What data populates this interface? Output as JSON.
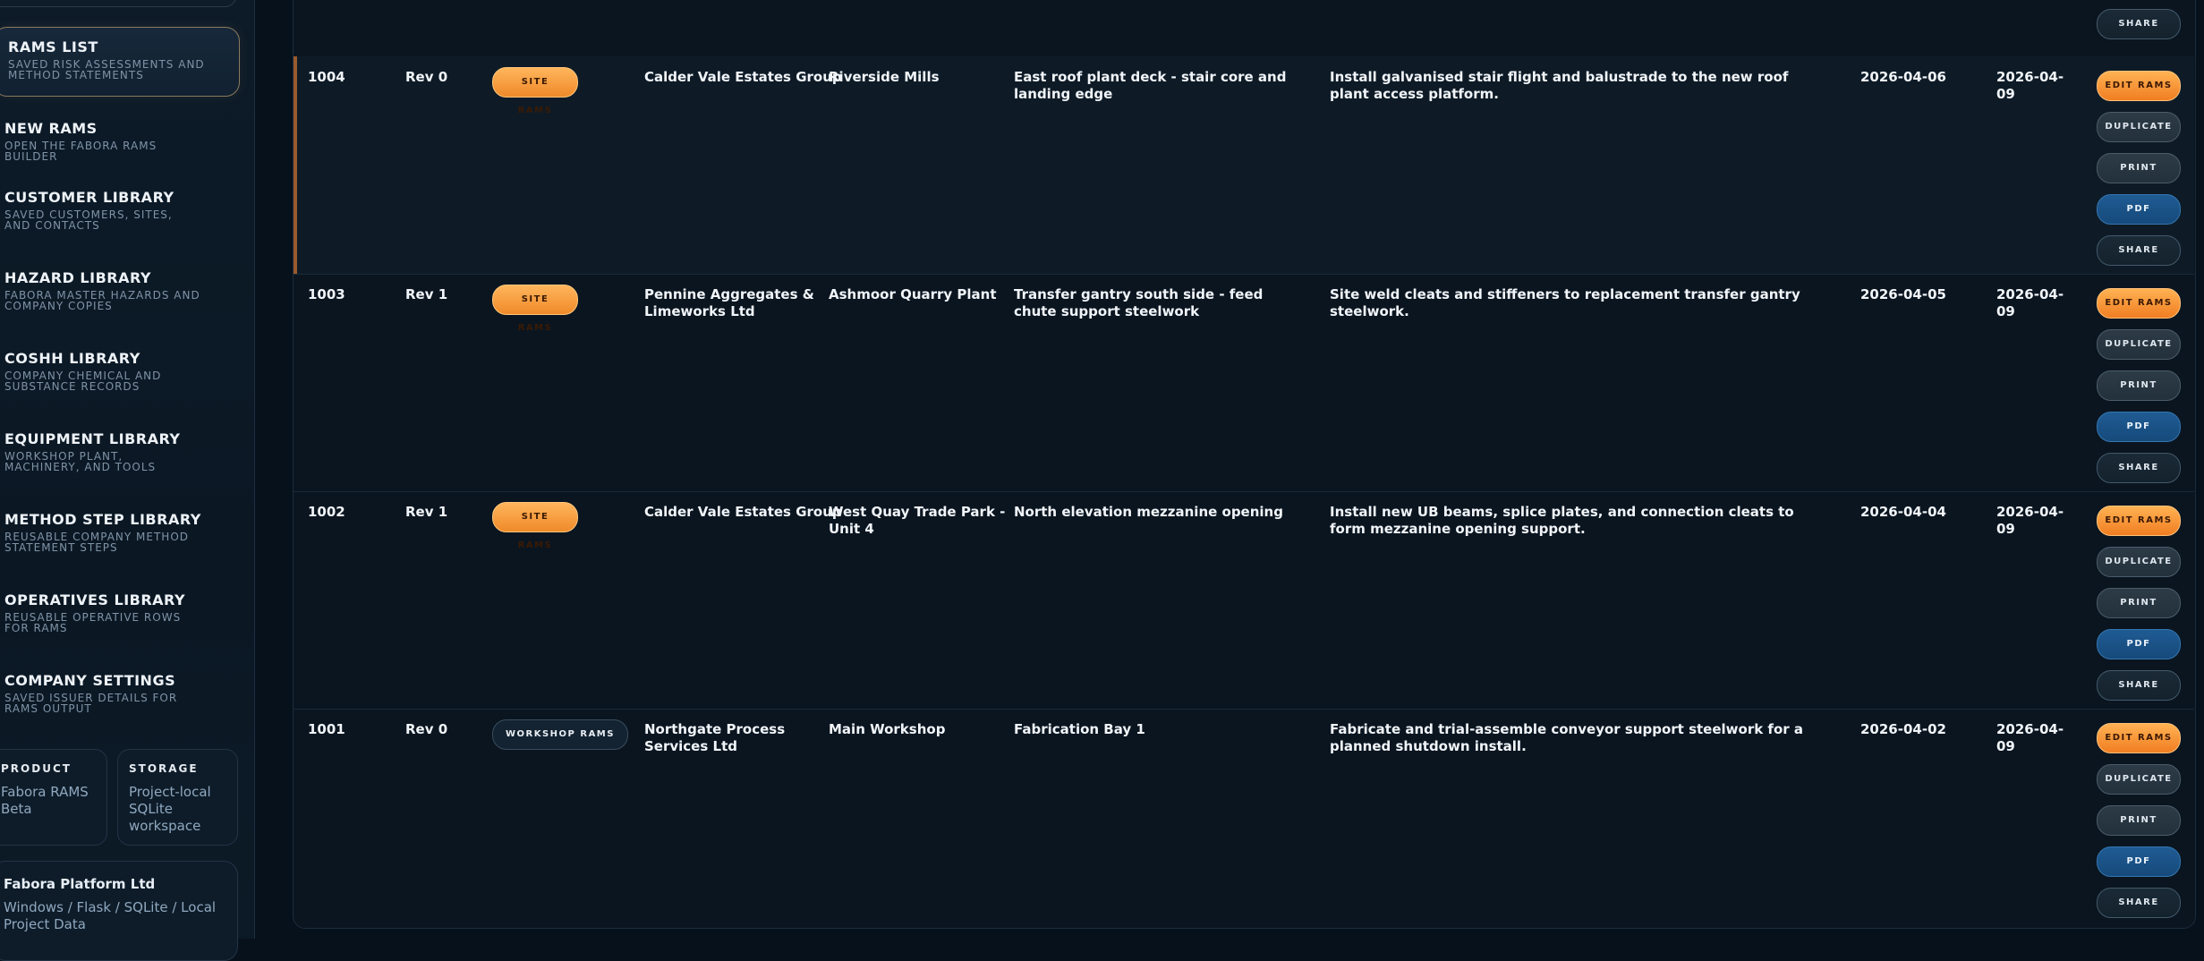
{
  "sidebar": {
    "nav": [
      {
        "title": "RAMS LIST",
        "subtitle": "SAVED RISK ASSESSMENTS AND METHOD STATEMENTS",
        "active": true
      },
      {
        "title": "NEW RAMS",
        "subtitle": "OPEN THE FABORA RAMS BUILDER"
      },
      {
        "title": "CUSTOMER LIBRARY",
        "subtitle": "SAVED CUSTOMERS, SITES, AND CONTACTS"
      },
      {
        "title": "HAZARD LIBRARY",
        "subtitle": "FABORA MASTER HAZARDS AND COMPANY COPIES"
      },
      {
        "title": "COSHH LIBRARY",
        "subtitle": "COMPANY CHEMICAL AND SUBSTANCE RECORDS"
      },
      {
        "title": "EQUIPMENT LIBRARY",
        "subtitle": "WORKSHOP PLANT, MACHINERY, AND TOOLS"
      },
      {
        "title": "METHOD STEP LIBRARY",
        "subtitle": "REUSABLE COMPANY METHOD STATEMENT STEPS"
      },
      {
        "title": "OPERATIVES LIBRARY",
        "subtitle": "REUSABLE OPERATIVE ROWS FOR RAMS"
      },
      {
        "title": "COMPANY SETTINGS",
        "subtitle": "SAVED ISSUER DETAILS FOR RAMS OUTPUT"
      }
    ],
    "product": {
      "label": "PRODUCT",
      "value": "Fabora RAMS Beta"
    },
    "storage": {
      "label": "STORAGE",
      "value": "Project-local SQLite workspace"
    },
    "company": {
      "name": "Fabora Platform Ltd",
      "desc": "Windows / Flask / SQLite / Local Project Data"
    }
  },
  "table": {
    "top_partial_button": "SHARE",
    "actions": {
      "edit": "EDIT RAMS",
      "duplicate": "DUPLICATE",
      "print": "PRINT",
      "pdf": "PDF",
      "share": "SHARE"
    },
    "rows": [
      {
        "id": "1004",
        "rev": "Rev 0",
        "type": "SITE RAMS",
        "customer": "Calder Vale Estates Group",
        "site": "Riverside Mills",
        "job": "East roof plant deck - stair core and landing edge",
        "scope": "Install galvanised stair flight and balustrade to the new roof plant access platform.",
        "date1": "2026-04-06",
        "date2": "2026-04-09"
      },
      {
        "id": "1003",
        "rev": "Rev 1",
        "type": "SITE RAMS",
        "customer": "Pennine Aggregates & Limeworks Ltd",
        "site": "Ashmoor Quarry Plant",
        "job": "Transfer gantry south side - feed chute support steelwork",
        "scope": "Site weld cleats and stiffeners to replacement transfer gantry steelwork.",
        "date1": "2026-04-05",
        "date2": "2026-04-09"
      },
      {
        "id": "1002",
        "rev": "Rev 1",
        "type": "SITE RAMS",
        "customer": "Calder Vale Estates Group",
        "site": "West Quay Trade Park - Unit 4",
        "job": "North elevation mezzanine opening",
        "scope": "Install new UB beams, splice plates, and connection cleats to form mezzanine opening support.",
        "date1": "2026-04-04",
        "date2": "2026-04-09"
      },
      {
        "id": "1001",
        "rev": "Rev 0",
        "type": "WORKSHOP RAMS",
        "customer": "Northgate Process Services Ltd",
        "site": "Main Workshop",
        "job": "Fabrication Bay 1",
        "scope": "Fabricate and trial-assemble conveyor support steelwork for a planned shutdown install.",
        "date1": "2026-04-02",
        "date2": "2026-04-09"
      }
    ]
  }
}
